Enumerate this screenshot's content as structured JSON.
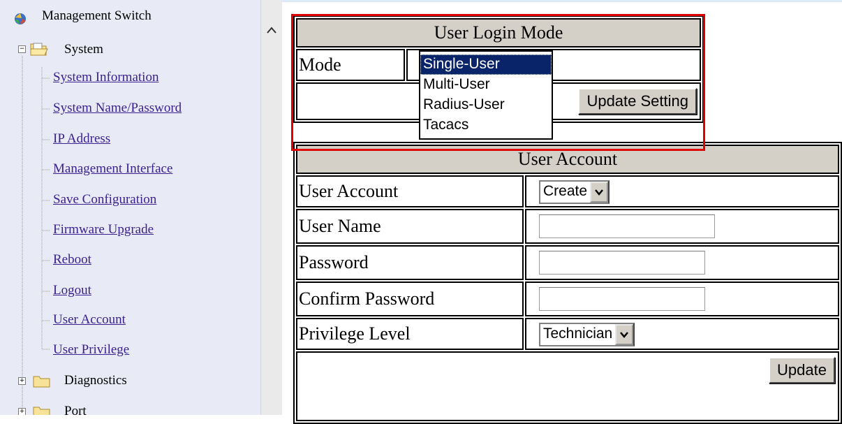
{
  "tree": {
    "root_label": "Management Switch",
    "system_label": "System",
    "system_links": [
      "System Information",
      "System Name/Password",
      "IP Address",
      "Management Interface",
      "Save Configuration",
      "Firmware Upgrade",
      "Reboot",
      "Logout",
      "User Account",
      "User Privilege"
    ],
    "diagnostics_label": "Diagnostics",
    "port_label": "Port"
  },
  "login_mode": {
    "title": "User Login Mode",
    "mode_label": "Mode",
    "options": [
      "Single-User",
      "Multi-User",
      "Radius-User",
      "Tacacs"
    ],
    "selected": "Single-User",
    "update_button": "Update Setting"
  },
  "user_account": {
    "title": "User Account",
    "account_label": "User Account",
    "account_value": "Create",
    "username_label": "User Name",
    "password_label": "Password",
    "confirm_label": "Confirm Password",
    "privilege_label": "Privilege Level",
    "privilege_value": "Technician",
    "update_button": "Update"
  },
  "colors": {
    "highlight": "#e00000",
    "tree_bg": "#e8eaf6",
    "selected_option": "#0a246a",
    "link": "#3a1f8f"
  }
}
